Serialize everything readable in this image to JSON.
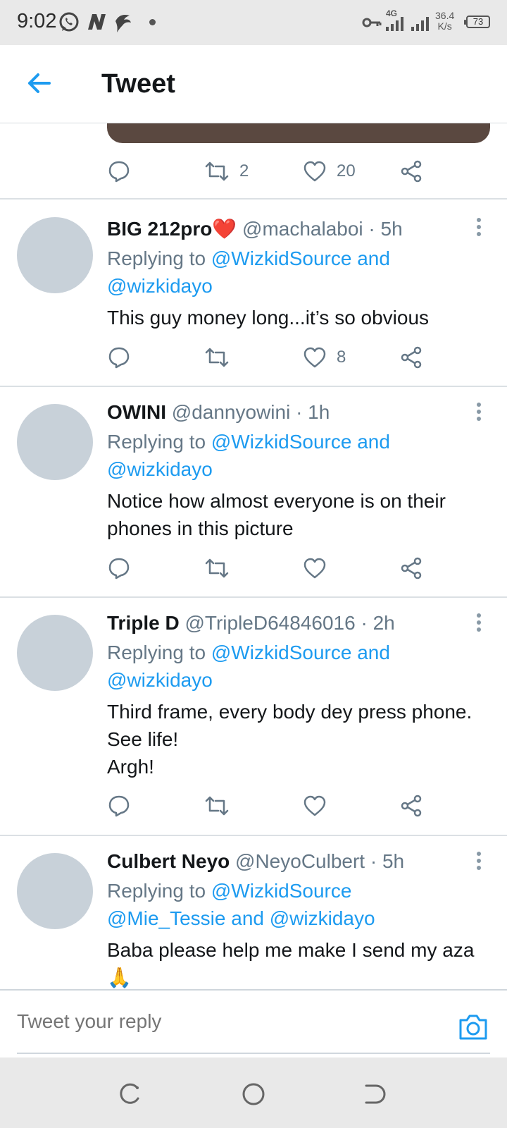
{
  "status_bar": {
    "time": "9:02",
    "network": "4G",
    "speed_value": "36.4",
    "speed_unit": "K/s",
    "battery": "73",
    "icons": [
      "whatsapp-icon",
      "n-app-icon",
      "hand-app-icon",
      "key-icon",
      "signal-icon",
      "signal-icon-2"
    ]
  },
  "header": {
    "title": "Tweet"
  },
  "previous_tweet": {
    "retweets": "2",
    "likes": "20"
  },
  "replies": [
    {
      "name": "BIG 212pro❤️",
      "handle": "@machalaboi · 5h",
      "replying_prefix": "Replying to ",
      "replying_line1": "@WizkidSource and",
      "replying_line2": "@wizkidayo",
      "text_lines": [
        "This guy money long...it’s so obvious"
      ],
      "retweets": "",
      "likes": "8"
    },
    {
      "name": "OWINI",
      "handle": "@dannyowini · 1h",
      "replying_prefix": "Replying to ",
      "replying_line1": "@WizkidSource and",
      "replying_line2": "@wizkidayo",
      "text_lines": [
        "Notice how almost everyone is on their",
        "phones in this picture"
      ],
      "retweets": "",
      "likes": ""
    },
    {
      "name": "Triple D",
      "handle": "@TripleD64846016 · 2h",
      "replying_prefix": "Replying to ",
      "replying_line1": "@WizkidSource and",
      "replying_line2": "@wizkidayo",
      "text_lines": [
        "Third frame, every body dey press phone.",
        "See life!",
        "Argh!"
      ],
      "retweets": "",
      "likes": ""
    },
    {
      "name": "Culbert Neyo",
      "handle": "@NeyoCulbert · 5h",
      "replying_prefix": "Replying to ",
      "replying_line1": "@WizkidSource",
      "replying_line2": "@Mie_Tessie and @wizkidayo",
      "text_lines": [
        "Baba please help me make I send my aza",
        "🙏"
      ],
      "retweets": "",
      "likes": ""
    }
  ],
  "composer": {
    "placeholder": "Tweet your reply"
  },
  "colors": {
    "accent": "#1d9bf0",
    "secondary_text": "#657786",
    "avatar_placeholder": "#c8d1d9"
  }
}
